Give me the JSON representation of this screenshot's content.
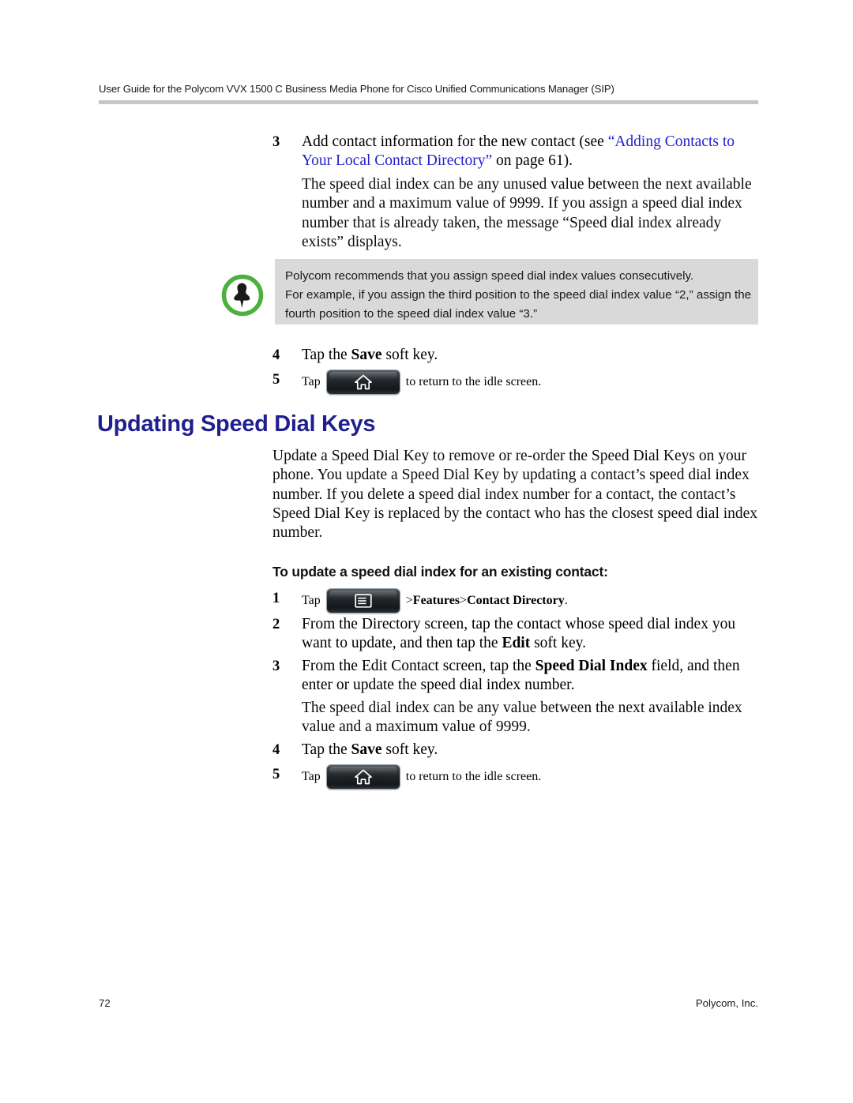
{
  "header": {
    "running_title": "User Guide for the Polycom VVX 1500 C Business Media Phone for Cisco Unified Communications Manager (SIP)"
  },
  "section_top": {
    "steps": [
      {
        "num": "3",
        "text_before_link": "Add contact information for the new contact (see ",
        "link_text": "“Adding Contacts to Your Local Contact Directory”",
        "text_after_link": " on page 61)."
      }
    ],
    "note_paragraph": "The speed dial index can be any unused value between the next available number and a maximum value of 9999. If you assign a speed dial index number that is already taken, the message “Speed dial index already exists” displays."
  },
  "note_box": {
    "icon": "pushpin-icon",
    "ring_color": "#4caf3f",
    "background": "#d9d9d9",
    "line1": "Polycom recommends that you assign speed dial index values consecutively.",
    "line2": "For example, if you assign the third position to the speed dial index value “2,” assign the fourth position to the speed dial index value “3.”"
  },
  "steps_after_note": [
    {
      "num": "4",
      "pre": "Tap the ",
      "bold": "Save",
      "post": " soft key."
    },
    {
      "num": "5",
      "pre": "Tap",
      "key": "home-key",
      "post": "to return to the idle screen."
    }
  ],
  "heading": {
    "title": "Updating Speed Dial Keys",
    "color": "#1f1f8f"
  },
  "body_paragraph": "Update a Speed Dial Key to remove or re-order the Speed Dial Keys on your phone. You update a Speed Dial Key by updating a contact’s speed dial index number. If you delete a speed dial index number for a contact, the contact’s Speed Dial Key is replaced by the contact who has the closest speed dial index number.",
  "subheading": "To update a speed dial index for an existing contact:",
  "procedure": {
    "step1": {
      "num": "1",
      "pre": "Tap",
      "key": "menu-key",
      "post_plain": " > ",
      "post_bold1": "Features",
      "post_plain2": " > ",
      "post_bold2": "Contact Directory",
      "post_plain3": "."
    },
    "step2": {
      "num": "2",
      "pre": "From the Directory screen, tap the contact whose speed dial index you want to update, and then tap the ",
      "bold": "Edit",
      "post": " soft key."
    },
    "step3": {
      "num": "3",
      "pre": "From the Edit Contact screen, tap the ",
      "bold": "Speed Dial Index",
      "post": " field, and then enter or update the speed dial index number."
    },
    "step3_note": "The speed dial index can be any value between the next available index value and a maximum value of 9999.",
    "step4": {
      "num": "4",
      "pre": "Tap the ",
      "bold": "Save",
      "post": " soft key."
    },
    "step5": {
      "num": "5",
      "pre": "Tap",
      "key": "home-key",
      "post": "to return to the idle screen."
    }
  },
  "footer": {
    "page_number": "72",
    "company": "Polycom, Inc."
  }
}
